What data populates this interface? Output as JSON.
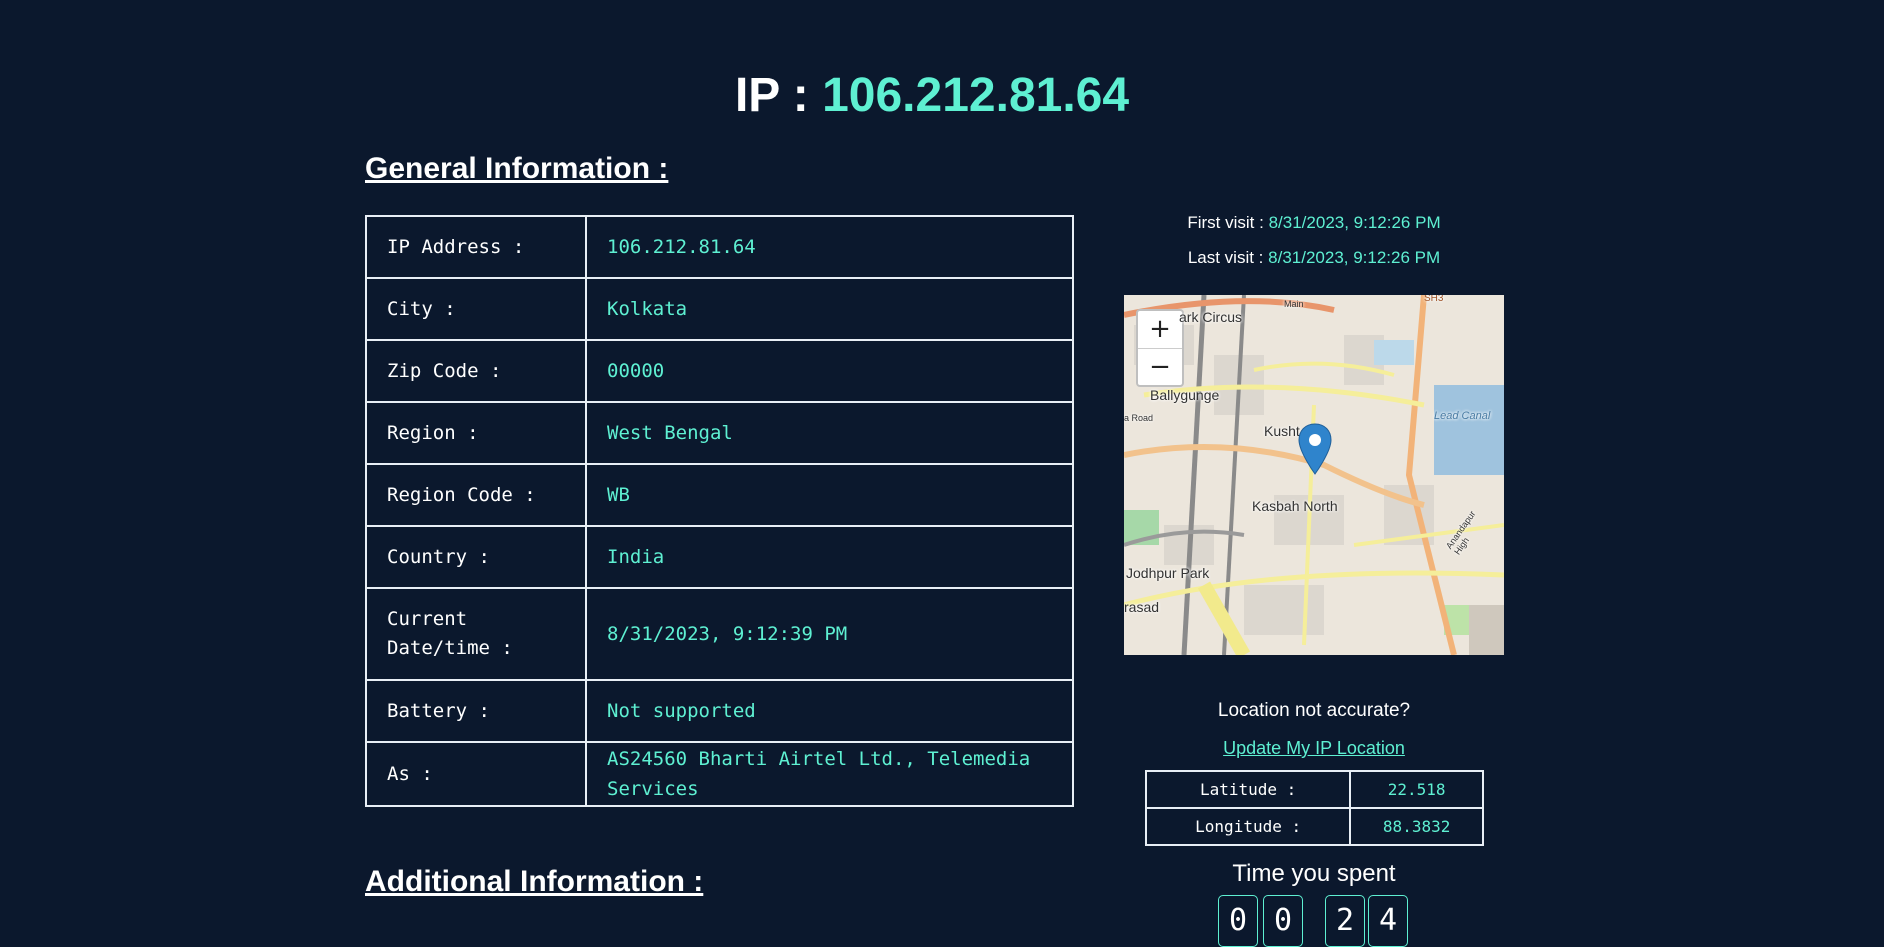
{
  "header": {
    "prefix": "IP :",
    "ip": "106.212.81.64"
  },
  "general_heading": "General Information :",
  "info_rows": [
    {
      "label": "IP Address :",
      "value": "106.212.81.64"
    },
    {
      "label": "City :",
      "value": "Kolkata"
    },
    {
      "label": "Zip Code :",
      "value": "00000"
    },
    {
      "label": "Region :",
      "value": "West Bengal"
    },
    {
      "label": "Region Code :",
      "value": "WB"
    },
    {
      "label": "Country :",
      "value": "India"
    },
    {
      "label": "Current Date/time :",
      "value": "8/31/2023, 9:12:39 PM"
    },
    {
      "label": "Battery :",
      "value": "Not supported"
    },
    {
      "label": "As :",
      "value": "AS24560 Bharti Airtel Ltd., Telemedia Services"
    }
  ],
  "visits": {
    "first_label": "First visit :",
    "first_value": "8/31/2023, 9:12:26 PM",
    "last_label": "Last visit :",
    "last_value": "8/31/2023, 9:12:26 PM"
  },
  "map": {
    "zoom_in": "+",
    "zoom_out": "−",
    "labels": {
      "park_circus": "ark Circus",
      "ballygunge": "Ballygunge",
      "kushtia": "Kusht",
      "kasbah": "Kasbah North",
      "jodhpur": "Jodhpur Park",
      "prasad": "rasad",
      "road": "a Road",
      "lead_canal": "Lead Canal",
      "anandapur": "Anandapur High",
      "sh3": "SH3",
      "main": "Main"
    }
  },
  "location_question": "Location not accurate?",
  "update_link": "Update My IP Location",
  "coords": [
    {
      "label": "Latitude :",
      "value": "22.518"
    },
    {
      "label": "Longitude :",
      "value": "88.3832"
    }
  ],
  "time_title": "Time you spent",
  "time_digits": [
    "0",
    "0",
    "2",
    "4"
  ],
  "additional_heading": "Additional Information :",
  "colors": {
    "background": "#0b182d",
    "accent": "#5ef0d2",
    "text": "#ffffff"
  }
}
